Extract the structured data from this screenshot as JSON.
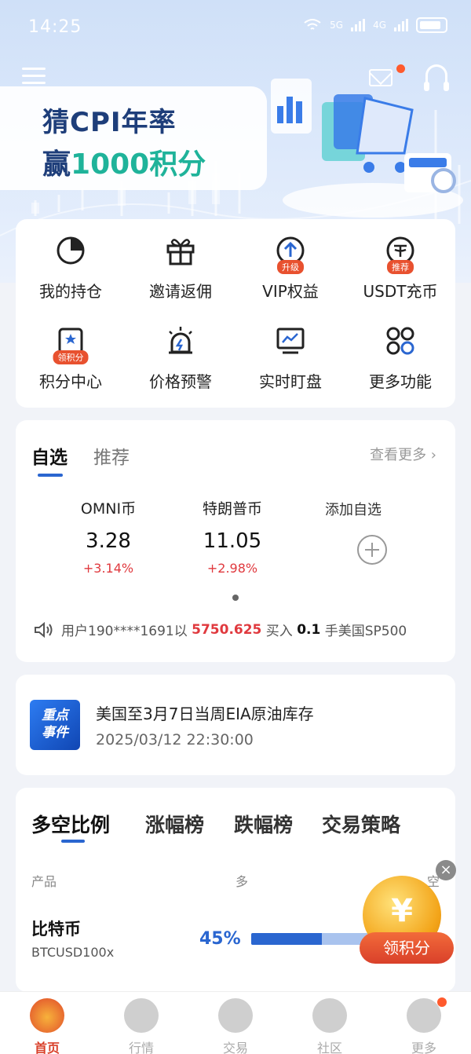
{
  "status_bar": {
    "time": "14:25",
    "net1": "5G",
    "net2": "4G"
  },
  "banner": {
    "line1": "猜CPI年率",
    "line2_prefix": "赢",
    "line2_highlight": "1000积分"
  },
  "quick_actions": [
    {
      "label": "我的持仓",
      "icon": "pie-chart-icon",
      "badge": ""
    },
    {
      "label": "邀请返佣",
      "icon": "gift-icon",
      "badge": ""
    },
    {
      "label": "VIP权益",
      "icon": "vip-up-icon",
      "badge": "升级"
    },
    {
      "label": "USDT充币",
      "icon": "usdt-icon",
      "badge": "推荐"
    },
    {
      "label": "积分中心",
      "icon": "points-icon",
      "badge": "领积分"
    },
    {
      "label": "价格预警",
      "icon": "alarm-icon",
      "badge": ""
    },
    {
      "label": "实时盯盘",
      "icon": "monitor-icon",
      "badge": ""
    },
    {
      "label": "更多功能",
      "icon": "grid-icon",
      "badge": ""
    }
  ],
  "watchlist": {
    "tab_active": "自选",
    "tab_other": "推荐",
    "see_more": "查看更多",
    "coins": [
      {
        "name": "OMNI币",
        "price": "3.28",
        "change": "+3.14%"
      },
      {
        "name": "特朗普币",
        "price": "11.05",
        "change": "+2.98%"
      }
    ],
    "add_label": "添加自选",
    "ticker": {
      "prefix": "用户190****1691以",
      "price": "5750.625",
      "mid": "买入",
      "qty": "0.1",
      "suffix": "手美国SP500"
    }
  },
  "event": {
    "badge_line1": "重点",
    "badge_line2": "事件",
    "title": "美国至3月7日当周EIA原油库存",
    "time": "2025/03/12 22:30:00"
  },
  "ratio": {
    "tabs": [
      "多空比例",
      "涨幅榜",
      "跌幅榜",
      "交易策略"
    ],
    "col_product": "产品",
    "col_long": "多",
    "col_short": "空",
    "rows": [
      {
        "name": "比特币",
        "code": "BTCUSD100x",
        "long_pct_text": "45%",
        "long_pct": 45
      }
    ]
  },
  "reward": {
    "close": "×",
    "coin_symbol": "¥",
    "button": "领积分"
  },
  "nav": [
    {
      "label": "首页",
      "active": true
    },
    {
      "label": "行情",
      "active": false
    },
    {
      "label": "交易",
      "active": false
    },
    {
      "label": "社区",
      "active": false
    },
    {
      "label": "更多",
      "active": false
    }
  ],
  "colors": {
    "accent": "#2a66d0",
    "up": "#e0393e",
    "brand_dark": "#1e3e7a",
    "highlight": "#1fb39a",
    "badge": "#e8512f"
  }
}
